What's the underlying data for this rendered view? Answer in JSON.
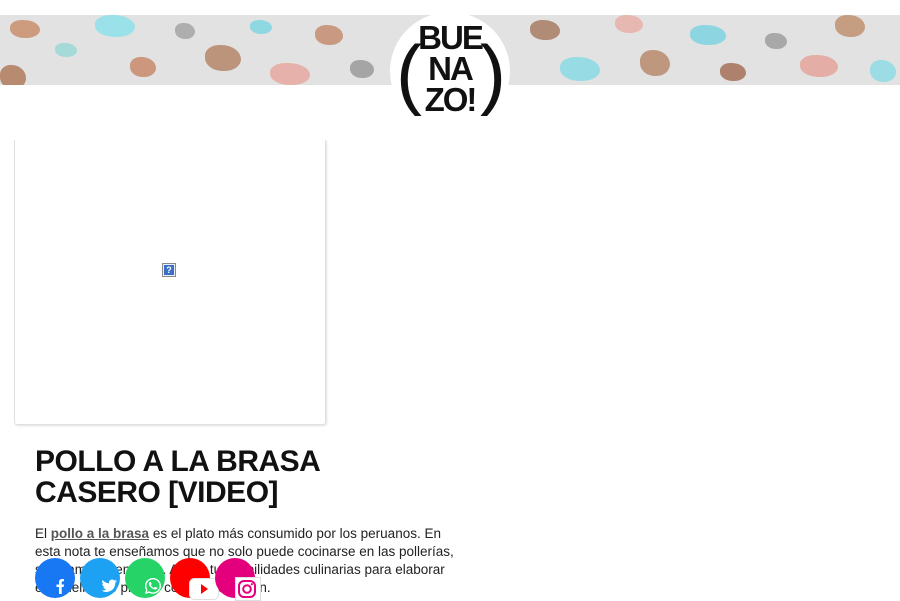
{
  "header": {
    "logo": {
      "line1": "BUE",
      "line2": "NA",
      "line3": "ZO!"
    }
  },
  "article": {
    "title_line1": "POLLO A LA BRASA",
    "title_line2": "CASERO [VIDEO]",
    "intro_prefix": "El ",
    "intro_link": "pollo a la brasa",
    "intro_rest": " es el plato más consumido por los peruanos. En esta nota te enseñamos que no solo puede cocinarse en las pollerías, sino también en casa. Aplica tus habilidades culinarias para elaborar este delicioso plato y conoce su origen."
  },
  "media": {
    "broken_image_glyph": "?"
  },
  "share": [
    {
      "name": "facebook",
      "color": "#1877f2",
      "icon": "facebook-icon"
    },
    {
      "name": "twitter",
      "color": "#1da1f2",
      "icon": "twitter-icon"
    },
    {
      "name": "whatsapp",
      "color": "#25d366",
      "icon": "whatsapp-icon"
    },
    {
      "name": "youtube",
      "color": "#ff0000",
      "icon": "youtube-icon"
    },
    {
      "name": "instagram",
      "color": "#e4007c",
      "icon": "instagram-icon"
    }
  ]
}
